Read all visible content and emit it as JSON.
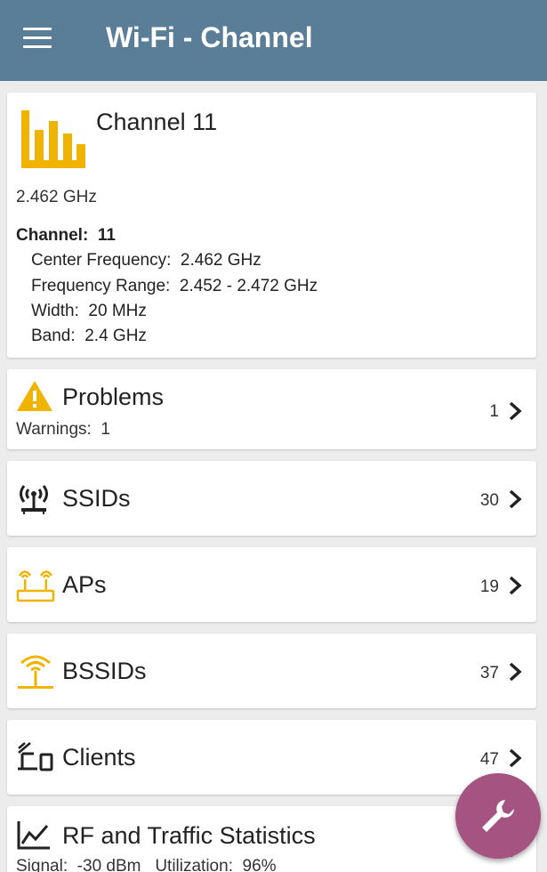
{
  "appbar": {
    "title": "Wi-Fi - Channel"
  },
  "channel": {
    "title": "Channel 11",
    "frequency": "2.462 GHz",
    "channel_label": "Channel:",
    "channel_value": "11",
    "center_frequency_label": "Center Frequency:",
    "center_frequency_value": "2.462 GHz",
    "frequency_range_label": "Frequency Range:",
    "frequency_range_value": "2.452 - 2.472 GHz",
    "width_label": "Width:",
    "width_value": "20 MHz",
    "band_label": "Band:",
    "band_value": "2.4 GHz"
  },
  "problems": {
    "label": "Problems",
    "count": "1",
    "sub_label": "Warnings:",
    "sub_value": "1"
  },
  "ssids": {
    "label": "SSIDs",
    "count": "30"
  },
  "aps": {
    "label": "APs",
    "count": "19"
  },
  "bssids": {
    "label": "BSSIDs",
    "count": "37"
  },
  "clients": {
    "label": "Clients",
    "count": "47"
  },
  "rf": {
    "label": "RF and Traffic Statistics",
    "signal_label": "Signal:",
    "signal_value": "-30 dBm",
    "utilization_label": "Utilization:",
    "utilization_value": "96%"
  },
  "colors": {
    "appbar": "#5a7d98",
    "accent_icon": "#f0b400",
    "fab": "#a55381"
  },
  "icons": {
    "menu": "hamburger-icon",
    "channel": "bar-chart-icon",
    "problems": "warning-icon",
    "ssids": "broadcast-antenna-icon",
    "aps": "access-point-icon",
    "bssids": "bssid-antenna-icon",
    "clients": "clients-devices-icon",
    "rf": "line-chart-icon",
    "fab": "wrench-icon",
    "chevron": "chevron-right-icon"
  }
}
